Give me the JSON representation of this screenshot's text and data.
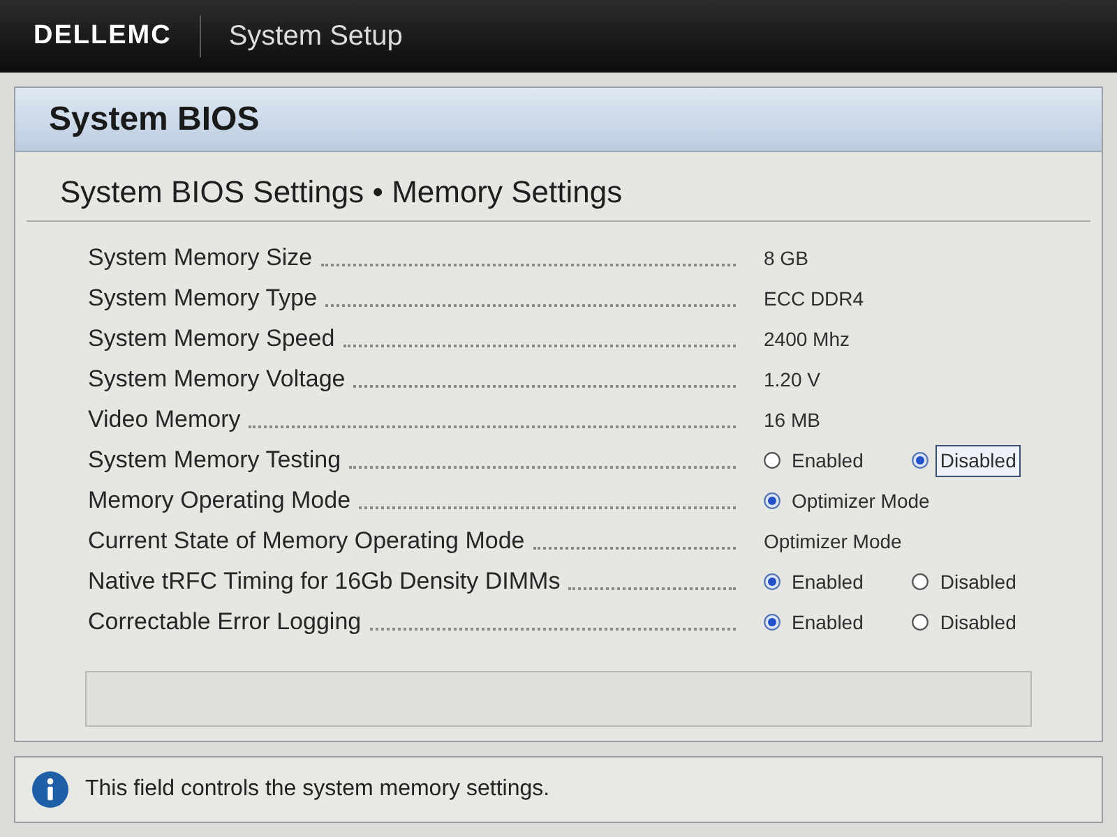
{
  "header": {
    "logo": "DELLEMC",
    "title": "System Setup"
  },
  "panel": {
    "title": "System BIOS",
    "subtitle": "System BIOS Settings • Memory Settings",
    "rows": [
      {
        "kind": "text",
        "label": "System Memory Size",
        "value": "8 GB"
      },
      {
        "kind": "text",
        "label": "System Memory Type",
        "value": "ECC DDR4"
      },
      {
        "kind": "text",
        "label": "System Memory Speed",
        "value": "2400 Mhz"
      },
      {
        "kind": "text",
        "label": "System Memory Voltage",
        "value": "1.20 V"
      },
      {
        "kind": "text",
        "label": "Video Memory",
        "value": "16 MB"
      },
      {
        "kind": "radio",
        "label": "System Memory Testing",
        "options": [
          {
            "label": "Enabled",
            "selected": false,
            "focused": false
          },
          {
            "label": "Disabled",
            "selected": true,
            "focused": true
          }
        ]
      },
      {
        "kind": "radio",
        "label": "Memory Operating Mode",
        "options": [
          {
            "label": "Optimizer Mode",
            "selected": true,
            "focused": false
          }
        ]
      },
      {
        "kind": "text",
        "label": "Current State of Memory Operating Mode",
        "value": "Optimizer Mode"
      },
      {
        "kind": "radio",
        "label": "Native tRFC Timing for 16Gb Density DIMMs",
        "options": [
          {
            "label": "Enabled",
            "selected": true,
            "focused": false
          },
          {
            "label": "Disabled",
            "selected": false,
            "focused": false
          }
        ]
      },
      {
        "kind": "radio",
        "label": "Correctable Error Logging",
        "options": [
          {
            "label": "Enabled",
            "selected": true,
            "focused": false
          },
          {
            "label": "Disabled",
            "selected": false,
            "focused": false
          }
        ]
      }
    ]
  },
  "help": {
    "text": "This field controls the system memory settings."
  }
}
